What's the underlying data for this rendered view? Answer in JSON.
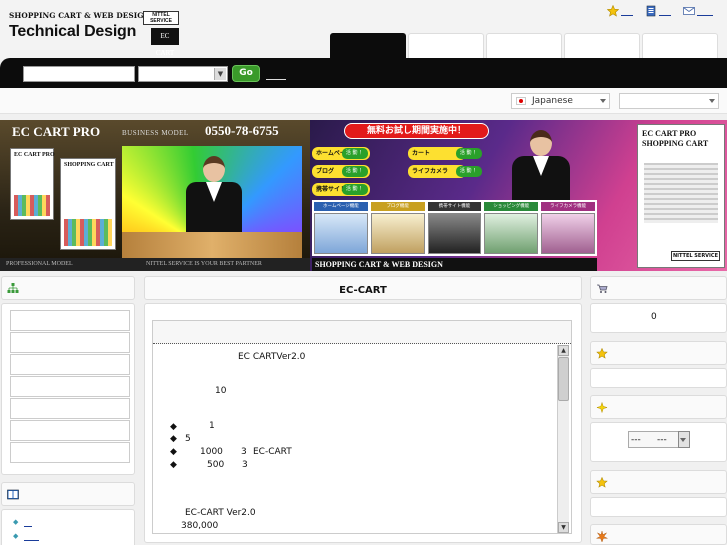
{
  "header": {
    "logo_line1": "SHOPPING CART & WEB DESIGN",
    "logo_line2": "Technical Design",
    "logo_nittel": "NITTEL SERVICE",
    "logo_badge": "EC CART"
  },
  "toplinks": [
    {
      "icon": "star-icon"
    },
    {
      "icon": "document-icon"
    },
    {
      "icon": "mail-icon"
    }
  ],
  "search": {
    "input_value": "",
    "go_label": "Go"
  },
  "lang": {
    "selected": "Japanese"
  },
  "banner": {
    "title": "EC CART PRO",
    "subtitle": "BUSINESS MODEL",
    "phone": "0550-78-6755",
    "trial": "無料お試し期間実施中！",
    "menu": [
      {
        "label": "ホームページ",
        "go": "活 動 ！"
      },
      {
        "label": "カート",
        "go": "活 動 ！"
      },
      {
        "label": "ブログ",
        "go": "活 動 ！"
      },
      {
        "label": "ライフカメラ",
        "go": "活 動 ！"
      },
      {
        "label": "携帯サイト",
        "go": "活 動 ！"
      }
    ],
    "thumbs": [
      "ホームページ機能",
      "ブログ機能",
      "携帯サイト機能",
      "ショッピング機能",
      "ライフカメラ機能"
    ],
    "box_title": "EC CART PRO",
    "box_sub": "SHOPPING CART",
    "box2_title": "EC CART PRO",
    "box2_sub": "SHOPPING CART",
    "box2_nt": "NITTEL SERVICE",
    "bottom_left1": "PROFESSIONAL MODEL",
    "bottom_left2": "NITTEL SERVICE IS YOUR BEST PARTNER",
    "bottom_right": "SHOPPING CART & WEB DESIGN"
  },
  "main": {
    "title": "EC-CART",
    "content": {
      "line1": "EC CARTVer2.0",
      "line2": "10",
      "b1": "◆",
      "b1_text": "1",
      "b2": "◆",
      "b2_text": "5",
      "b3": "◆",
      "b3_text": "1000",
      "b3_text2": "3",
      "b3_text3": "EC-CART",
      "b4": "◆",
      "b4_text": "500",
      "b4_text2": "3",
      "line_ver": "EC-CART Ver2.0",
      "price": "380,000"
    }
  },
  "right": {
    "cart_count": "0",
    "select_value": "---",
    "select_value2": "---"
  },
  "left": {
    "bullets": [
      "◆",
      "◆"
    ]
  }
}
